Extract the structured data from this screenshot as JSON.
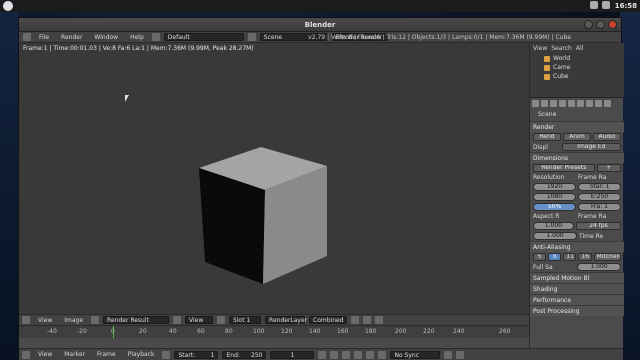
{
  "system": {
    "time": "16:58"
  },
  "window": {
    "title": "Blender"
  },
  "menu": {
    "items": [
      "File",
      "Render",
      "Window",
      "Help"
    ]
  },
  "header": {
    "layout": "Default",
    "scene": "Scene",
    "engine": "Blender Render",
    "stats": "v2.79 | Verts:8 | Faces:6 | Tris:12 | Objects:1/3 | Lamps:0/1 | Mem:7.36M (9.99M) | Cube"
  },
  "viewport": {
    "stats": "Frame:1 | Time:00:01.03 | Ve:8 Fa:6 La:1 | Mem:7.36M (9.99M, Peak 28.27M)"
  },
  "image_editor": {
    "items": [
      "View",
      "Image"
    ],
    "image_name": "Render Result",
    "view": "View",
    "slot": "Slot 1",
    "layer": "RenderLayer",
    "pass": "Combined"
  },
  "timeline": {
    "ticks": [
      "-40",
      "-20",
      "0",
      "20",
      "40",
      "60",
      "80",
      "100",
      "120",
      "140",
      "160",
      "180",
      "200",
      "220",
      "240",
      "260"
    ],
    "menu": [
      "View",
      "Marker",
      "Frame",
      "Playback"
    ],
    "start_label": "Start:",
    "start": "1",
    "end_label": "End:",
    "end": "250",
    "current": "1",
    "sync": "No Sync"
  },
  "outliner": {
    "tabs": [
      "View",
      "Search",
      "All"
    ],
    "items": [
      "World",
      "Came",
      "Cube"
    ]
  },
  "properties": {
    "scene": "Scene",
    "render_panel": "Render",
    "render_buttons": [
      "Rend",
      "Anim",
      "Audio"
    ],
    "display_label": "Displ",
    "display_value": "Image Ed",
    "dimensions_panel": "Dimensions",
    "presets": "Render Presets",
    "resolution_label": "Resolution",
    "frame_range_label": "Frame Ra",
    "res_x": "1920",
    "res_y": "1080",
    "res_pct": "50%",
    "start": "Star: 1",
    "end": "E:250",
    "frame": "Fra: 1",
    "aspect_label": "Aspect R",
    "frame_rate_label": "Frame Ra",
    "aspect_x": "1.000",
    "aspect_y": "1.000",
    "fps": "24 fps",
    "time_label": "Time Re",
    "aa_panel": "Anti-Aliasing",
    "aa_values": [
      "5",
      "8",
      "11",
      "16"
    ],
    "aa_filter": "Mitchell-",
    "full_sample": "Full Sa",
    "filter_size": "1.000",
    "motion_blur": "Sampled Motion Bl",
    "shading": "Shading",
    "performance": "Performance",
    "post_processing": "Post Processing"
  }
}
